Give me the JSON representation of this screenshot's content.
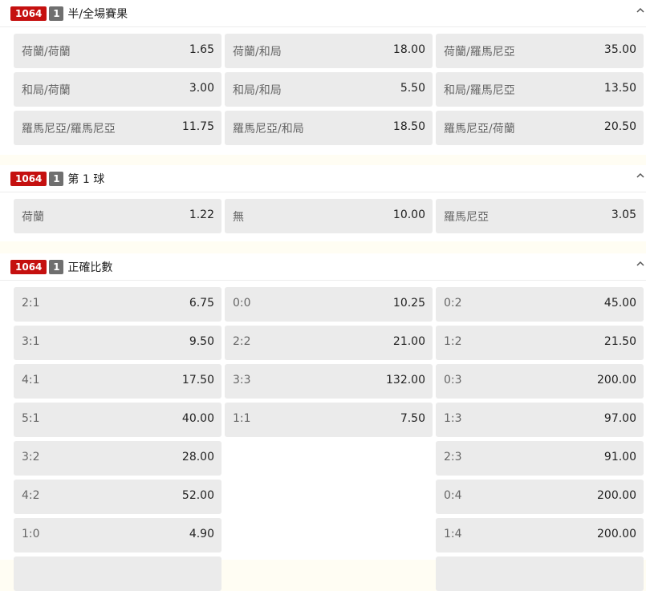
{
  "sections": [
    {
      "id_badge": "1064",
      "num_badge": "1",
      "title": "半/全場賽果",
      "rows": [
        [
          {
            "label": "荷蘭/荷蘭",
            "odds": "1.65"
          },
          {
            "label": "荷蘭/和局",
            "odds": "18.00"
          },
          {
            "label": "荷蘭/羅馬尼亞",
            "odds": "35.00"
          }
        ],
        [
          {
            "label": "和局/荷蘭",
            "odds": "3.00"
          },
          {
            "label": "和局/和局",
            "odds": "5.50"
          },
          {
            "label": "和局/羅馬尼亞",
            "odds": "13.50"
          }
        ],
        [
          {
            "label": "羅馬尼亞/羅馬尼亞",
            "odds": "11.75"
          },
          {
            "label": "羅馬尼亞/和局",
            "odds": "18.50"
          },
          {
            "label": "羅馬尼亞/荷蘭",
            "odds": "20.50"
          }
        ]
      ]
    },
    {
      "id_badge": "1064",
      "num_badge": "1",
      "title": "第 1 球",
      "rows": [
        [
          {
            "label": "荷蘭",
            "odds": "1.22"
          },
          {
            "label": "無",
            "odds": "10.00"
          },
          {
            "label": "羅馬尼亞",
            "odds": "3.05"
          }
        ]
      ]
    },
    {
      "id_badge": "1064",
      "num_badge": "1",
      "title": "正確比數",
      "rows": [
        [
          {
            "label": "2:1",
            "odds": "6.75"
          },
          {
            "label": "0:0",
            "odds": "10.25"
          },
          {
            "label": "0:2",
            "odds": "45.00"
          }
        ],
        [
          {
            "label": "3:1",
            "odds": "9.50"
          },
          {
            "label": "2:2",
            "odds": "21.00"
          },
          {
            "label": "1:2",
            "odds": "21.50"
          }
        ],
        [
          {
            "label": "4:1",
            "odds": "17.50"
          },
          {
            "label": "3:3",
            "odds": "132.00"
          },
          {
            "label": "0:3",
            "odds": "200.00"
          }
        ],
        [
          {
            "label": "5:1",
            "odds": "40.00"
          },
          {
            "label": "1:1",
            "odds": "7.50"
          },
          {
            "label": "1:3",
            "odds": "97.00"
          }
        ],
        [
          {
            "label": "3:2",
            "odds": "28.00"
          },
          null,
          {
            "label": "2:3",
            "odds": "91.00"
          }
        ],
        [
          {
            "label": "4:2",
            "odds": "52.00"
          },
          null,
          {
            "label": "0:4",
            "odds": "200.00"
          }
        ],
        [
          {
            "label": "1:0",
            "odds": "4.90"
          },
          null,
          {
            "label": "1:4",
            "odds": "200.00"
          }
        ],
        [
          {
            "label": "",
            "odds": ""
          },
          null,
          {
            "label": "",
            "odds": ""
          }
        ]
      ]
    }
  ]
}
